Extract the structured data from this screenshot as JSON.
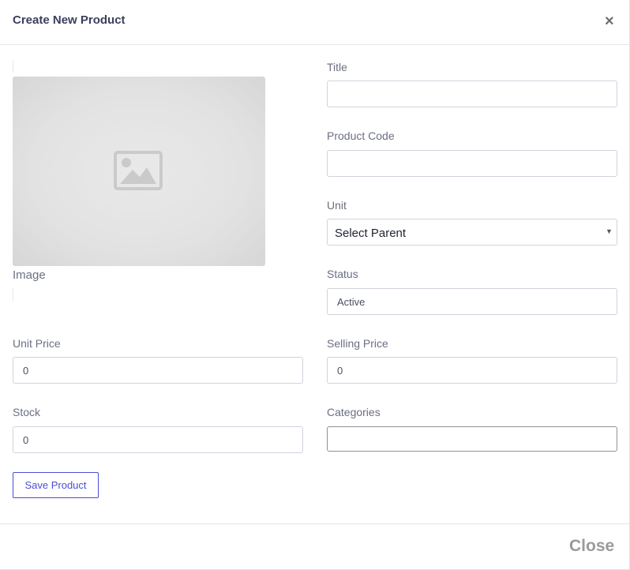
{
  "modal": {
    "title": "Create New Product",
    "close_icon": "×"
  },
  "image": {
    "label": "Image",
    "icon": "image-placeholder-icon"
  },
  "fields": {
    "title": {
      "label": "Title",
      "value": ""
    },
    "product_code": {
      "label": "Product Code",
      "value": ""
    },
    "unit": {
      "label": "Unit",
      "selected": "Select Parent"
    },
    "status": {
      "label": "Status",
      "value": "Active"
    },
    "unit_price": {
      "label": "Unit Price",
      "value": "0"
    },
    "selling_price": {
      "label": "Selling Price",
      "value": "0"
    },
    "stock": {
      "label": "Stock",
      "value": "0"
    },
    "categories": {
      "label": "Categories",
      "value": ""
    }
  },
  "actions": {
    "save_label": "Save Product",
    "close_label": "Close"
  },
  "colors": {
    "accent": "#4a4fd6",
    "title_text": "#3b3f5c",
    "label_text": "#6b6f82"
  }
}
